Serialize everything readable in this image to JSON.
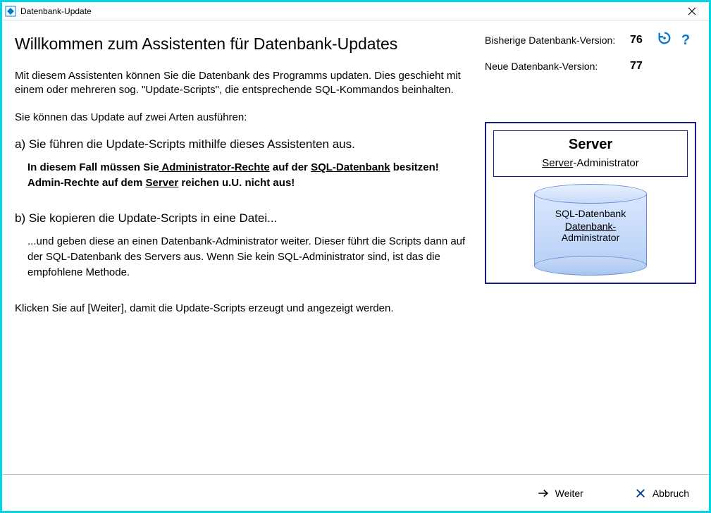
{
  "window": {
    "title": "Datenbank-Update"
  },
  "heading": "Willkommen zum Assistenten für Datenbank-Updates",
  "intro": "Mit diesem Assistenten können Sie die Datenbank des Programms updaten. Dies geschieht mit einem oder mehreren sog. \"Update-Scripts\", die entsprechende SQL-Kommandos beinhalten.",
  "ways_line": "Sie können das Update auf zwei Arten ausführen:",
  "option_a": {
    "title": "a) Sie führen die Update-Scripts mithilfe dieses Assistenten aus.",
    "note_pre": "In diesem Fall müssen Sie",
    "note_admin": " Administrator-Rechte",
    "note_mid": " auf der ",
    "note_sqldb": "SQL-Datenbank",
    "note_post1": " besitzen! Admin-Rechte auf dem ",
    "note_server": "Server",
    "note_post2": " reichen u.U. nicht aus!"
  },
  "option_b": {
    "title": "b) Sie kopieren die Update-Scripts in eine Datei...",
    "body": "...und geben diese an einen Datenbank-Administrator weiter. Dieser führt die Scripts dann auf der SQL-Datenbank des Servers aus. Wenn Sie kein SQL-Administrator sind, ist das die empfohlene Methode."
  },
  "footer_hint": "Klicken Sie auf [Weiter], damit die Update-Scripts erzeugt und angezeigt werden.",
  "versions": {
    "prev_label": "Bisherige Datenbank-Version:",
    "prev_value": "76",
    "new_label": "Neue Datenbank-Version:",
    "new_value": "77"
  },
  "diagram": {
    "server_title": "Server",
    "server_admin_ul": "Server",
    "server_admin_rest": "-Administrator",
    "db_title": "SQL-Datenbank",
    "db_admin_ul": "Datenbank",
    "db_admin_rest": "-",
    "db_admin_line2": "Administrator"
  },
  "buttons": {
    "next": "Weiter",
    "cancel": "Abbruch"
  },
  "help_symbol": "?"
}
